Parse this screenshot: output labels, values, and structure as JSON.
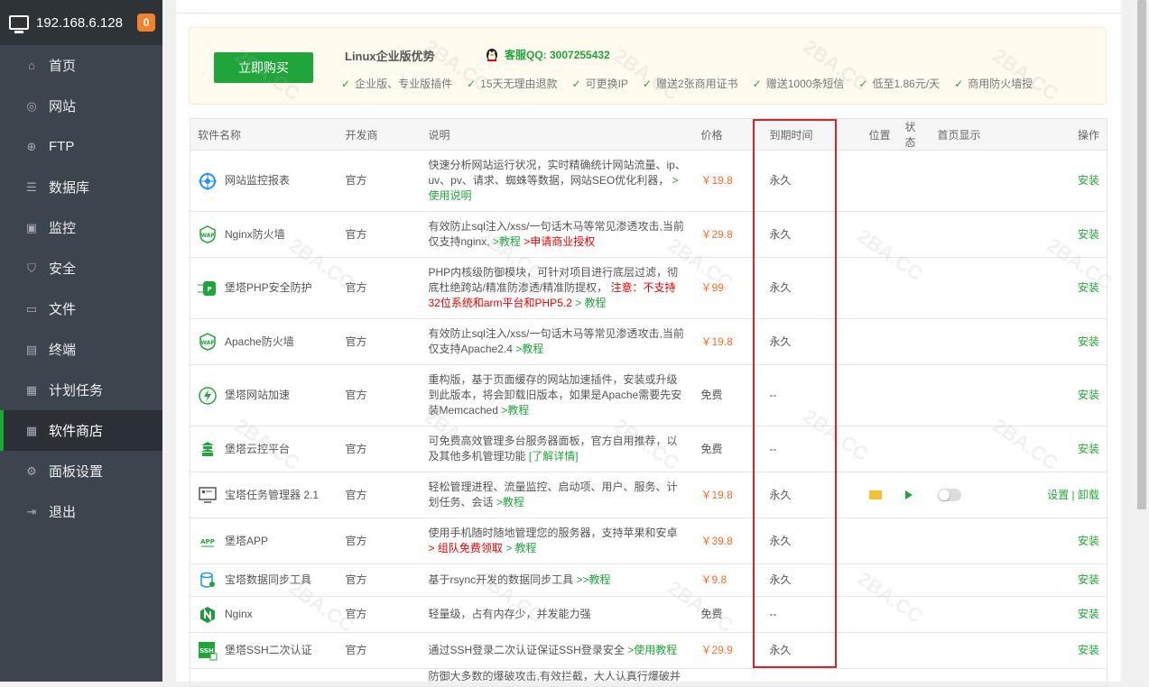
{
  "sidebar": {
    "ip": "192.168.6.128",
    "badge": "0",
    "items": [
      {
        "label": "首页",
        "icon": "home-icon"
      },
      {
        "label": "网站",
        "icon": "globe-icon"
      },
      {
        "label": "FTP",
        "icon": "ftp-icon"
      },
      {
        "label": "数据库",
        "icon": "database-icon"
      },
      {
        "label": "监控",
        "icon": "monitor-icon"
      },
      {
        "label": "安全",
        "icon": "shield-icon"
      },
      {
        "label": "文件",
        "icon": "folder-icon"
      },
      {
        "label": "终端",
        "icon": "terminal-icon"
      },
      {
        "label": "计划任务",
        "icon": "calendar-icon"
      },
      {
        "label": "软件商店",
        "icon": "grid-icon"
      },
      {
        "label": "面板设置",
        "icon": "gear-icon"
      },
      {
        "label": "退出",
        "icon": "logout-icon"
      }
    ],
    "active_index": 9
  },
  "promo": {
    "buy_label": "立即购买",
    "title": "Linux企业版优势",
    "qq": "客服QQ: 3007255432",
    "features": [
      "企业版、专业版插件",
      "15天无理由退款",
      "可更换IP",
      "赠送2张商用证书",
      "赠送1000条短信",
      "低至1.86元/天",
      "商用防火墙授"
    ]
  },
  "table": {
    "headers": {
      "name": "软件名称",
      "dev": "开发商",
      "desc": "说明",
      "price": "价格",
      "expire": "到期时间",
      "pos": "位置",
      "status": "状态",
      "home": "首页显示",
      "op": "操作"
    },
    "rows": [
      {
        "name": "网站监控报表",
        "icon": "site-monitor-icon",
        "dev": "官方",
        "desc": "快速分析网站运行状况，实时精确统计网站流量、ip、uv、pv、请求、蜘蛛等数据，网站SEO优化利器，",
        "link": ">使用说明",
        "link2": "",
        "price": "￥19.8",
        "expire": "永久",
        "op": "安装"
      },
      {
        "name": "Nginx防火墙",
        "icon": "waf-icon",
        "dev": "官方",
        "desc": "有效防止sql注入/xss/一句话木马等常见渗透攻击,当前仅支持nginx,",
        "link": ">教程",
        "link2": ">申请商业授权",
        "price": "￥29.8",
        "expire": "永久",
        "op": "安装"
      },
      {
        "name": "堡塔PHP安全防护",
        "icon": "php-guard-icon",
        "dev": "官方",
        "desc": "PHP内核级防御模块，可针对项目进行底层过滤，彻底杜绝跨站/精准防渗透/精准防提权，",
        "warn": "注意：不支持32位系统和arm平台和PHP5.2",
        "link": "> 教程",
        "price": "￥99",
        "expire": "永久",
        "op": "安装"
      },
      {
        "name": "Apache防火墙",
        "icon": "waf-icon",
        "dev": "官方",
        "desc": "有效防止sql注入/xss/一句话木马等常见渗透攻击,当前仅支持Apache2.4",
        "link": ">教程",
        "link2": "",
        "price": "￥19.8",
        "expire": "永久",
        "op": "安装"
      },
      {
        "name": "堡塔网站加速",
        "icon": "bolt-icon",
        "dev": "官方",
        "desc": "重构版，基于页面缓存的网站加速插件，安装或升级到此版本，将会卸载旧版本，如果是Apache需要先安装Memcached",
        "link": ">教程",
        "link2": "",
        "price": "免费",
        "expire": "--",
        "op": "安装"
      },
      {
        "name": "堡塔云控平台",
        "icon": "cloud-control-icon",
        "dev": "官方",
        "desc": "可免费高效管理多台服务器面板，官方自用推荐，以及其他多机管理功能",
        "link": "[了解详情]",
        "link2": "",
        "price": "免费",
        "expire": "--",
        "op": "安装"
      },
      {
        "name": "宝塔任务管理器 2.1",
        "icon": "task-manager-icon",
        "dev": "官方",
        "desc": "轻松管理进程、流量监控、启动项、用户、服务、计划任务、会话",
        "link": ">教程",
        "link2": "",
        "price": "￥19.8",
        "expire": "永久",
        "op": "设置 | 卸载",
        "installed": true
      },
      {
        "name": "堡塔APP",
        "icon": "app-icon",
        "dev": "官方",
        "desc": "使用手机随时随地管理您的服务器，支持苹果和安卓",
        "warn": "> 组队免费领取",
        "link": "> 教程",
        "price": "￥39.8",
        "expire": "永久",
        "op": "安装"
      },
      {
        "name": "宝塔数据同步工具",
        "icon": "sync-icon",
        "dev": "官方",
        "desc": "基于rsync开发的数据同步工具",
        "link": ">>教程",
        "link2": "",
        "price": "￥9.8",
        "expire": "永久",
        "op": "安装"
      },
      {
        "name": "Nginx",
        "icon": "nginx-icon",
        "dev": "官方",
        "desc": "轻量级，占有内存少，并发能力强",
        "link": "",
        "link2": "",
        "price": "免费",
        "expire": "--",
        "op": "安装"
      },
      {
        "name": "堡塔SSH二次认证",
        "icon": "ssh-icon",
        "dev": "官方",
        "desc": "通过SSH登录二次认证保证SSH登录安全",
        "link": ">使用教程",
        "link2": "",
        "price": "￥29.9",
        "expire": "永久",
        "op": "安装"
      },
      {
        "name": "",
        "icon": "",
        "dev": "",
        "desc": "防御大多数的爆破攻击,有效拦截，大人认真行爆破并",
        "link": "",
        "link2": "",
        "price": "",
        "expire": "",
        "op": ""
      }
    ]
  },
  "watermark": "2BA.CC",
  "colors": {
    "accent": "#20a53a",
    "price": "#fc6d26",
    "highlight": "#d8232a",
    "sidebar": "#3c444d"
  }
}
